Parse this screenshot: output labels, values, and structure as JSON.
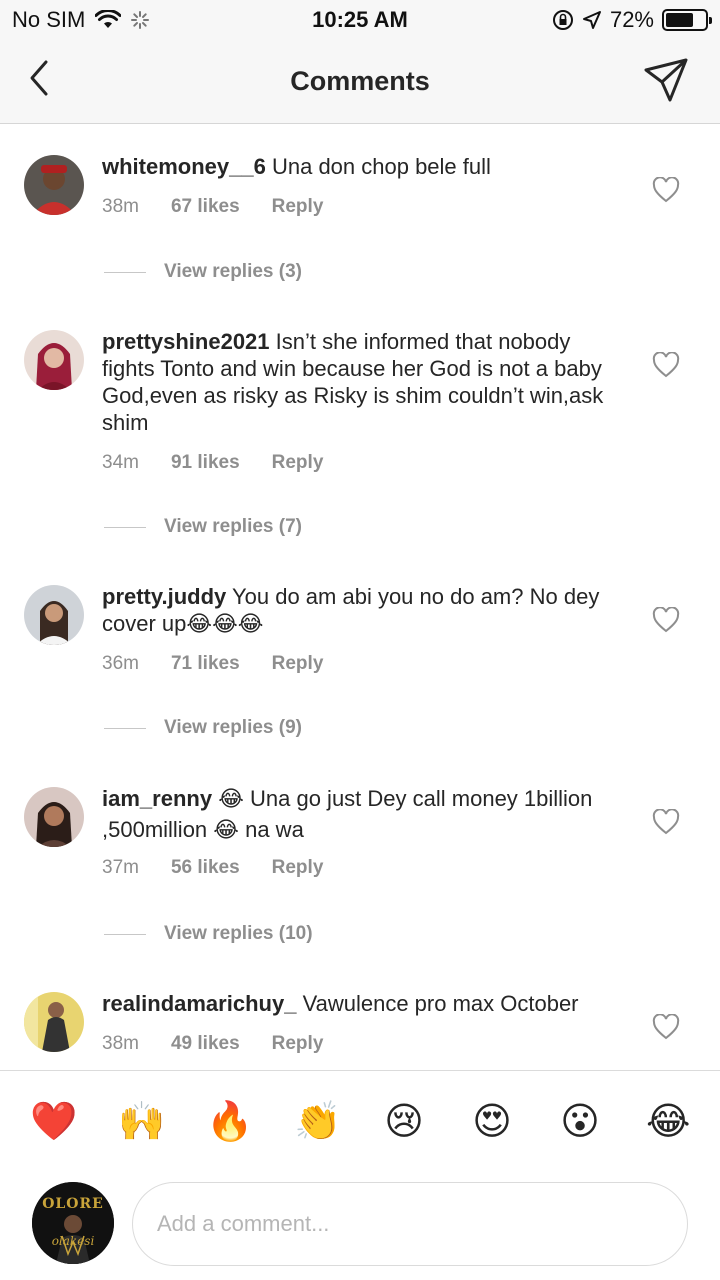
{
  "status_bar": {
    "carrier": "No SIM",
    "time": "10:25 AM",
    "battery_text": "72%",
    "battery_level": 0.72
  },
  "nav": {
    "title": "Comments",
    "back_icon": "chevron-left-icon",
    "send_icon": "paper-plane-icon"
  },
  "comments": [
    {
      "username": "whitemoney__6",
      "text": "Una don chop bele full",
      "time": "38m",
      "likes": "67 likes",
      "reply": "Reply",
      "view_replies": "View replies (3)"
    },
    {
      "username": "prettyshine2021",
      "text": "Isn’t she informed that nobody fights Tonto and win because her God is not a baby God,even as risky as Risky is shim couldn’t win,ask shim",
      "time": "34m",
      "likes": "91 likes",
      "reply": "Reply",
      "view_replies": "View replies (7)"
    },
    {
      "username": "pretty.juddy",
      "text": "You do am abi you no do am? No dey cover up😂😂😂",
      "time": "36m",
      "likes": "71 likes",
      "reply": "Reply",
      "view_replies": "View replies (9)"
    },
    {
      "username": "iam_renny",
      "text": "😂 Una go just Dey call money 1billion ,500million 😂 na wa",
      "time": "37m",
      "likes": "56 likes",
      "reply": "Reply",
      "view_replies": "View replies (10)"
    },
    {
      "username": "realindamarichuy_",
      "text": "Vawulence pro max October",
      "time": "38m",
      "likes": "49 likes",
      "reply": "Reply"
    }
  ],
  "reactions": [
    "❤️",
    "🙌",
    "🔥",
    "👏",
    "😢",
    "😍",
    "😮",
    "😂"
  ],
  "composer": {
    "placeholder": "Add a comment...",
    "avatar_text": "OLORE",
    "avatar_subtext": "olakesi"
  },
  "colors": {
    "text": "#262626",
    "muted": "#8e8e8e",
    "bar_bg": "#f7f7f7",
    "divider": "#dbdbdb"
  }
}
